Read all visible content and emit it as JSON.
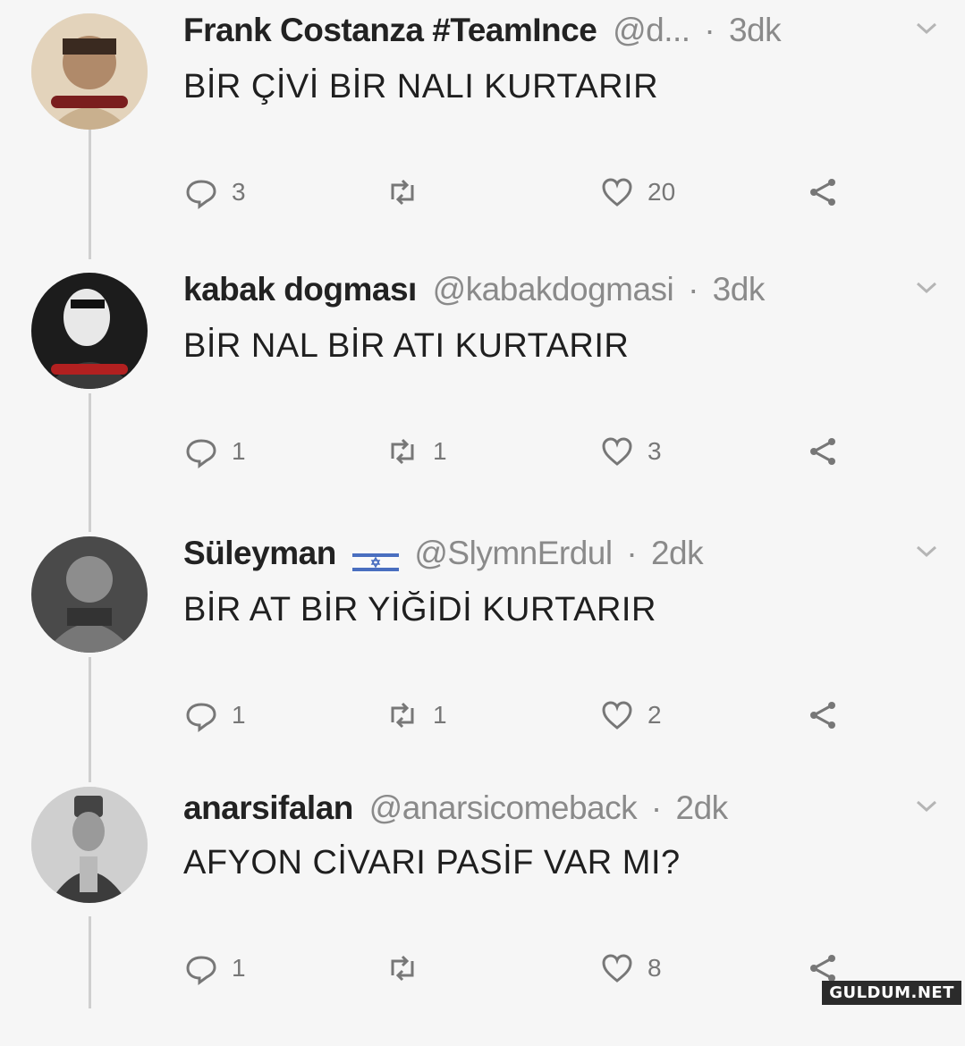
{
  "tweets": [
    {
      "name": "Frank Costanza #TeamInce",
      "handle": "@d...",
      "separator": "·",
      "time": "3dk",
      "text": "BİR ÇİVİ BİR NALI KURTARIR",
      "replies": "3",
      "retweets": "",
      "likes": "20",
      "avatar_color": "#d9c4a6"
    },
    {
      "name": "kabak dogması",
      "handle": "@kabakdogmasi",
      "separator": "·",
      "time": "3dk",
      "text": "BİR NAL BİR ATI KURTARIR",
      "replies": "1",
      "retweets": "1",
      "likes": "3",
      "avatar_color": "#2a2a2a"
    },
    {
      "name": "Süleyman",
      "flag": "🇮🇱",
      "handle": "@SlymnErdul",
      "separator": "·",
      "time": "2dk",
      "text": "BİR AT BİR YİĞİDİ KURTARIR",
      "replies": "1",
      "retweets": "1",
      "likes": "2",
      "avatar_color": "#6a6a6a"
    },
    {
      "name": "anarsifalan",
      "handle": "@anarsicomeback",
      "separator": "·",
      "time": "2dk",
      "text": "AFYON CİVARI PASİF VAR MI?",
      "replies": "1",
      "retweets": "",
      "likes": "8",
      "avatar_color": "#bdbdbd"
    }
  ],
  "watermark": "GULDUM.NET",
  "colors": {
    "background": "#f6f6f6",
    "thread_line": "#cfcfcf",
    "muted": "#8a8a8a",
    "text": "#1f1f1f"
  },
  "icons": [
    "reply-icon",
    "retweet-icon",
    "like-icon",
    "share-icon",
    "chevron-down-icon"
  ]
}
